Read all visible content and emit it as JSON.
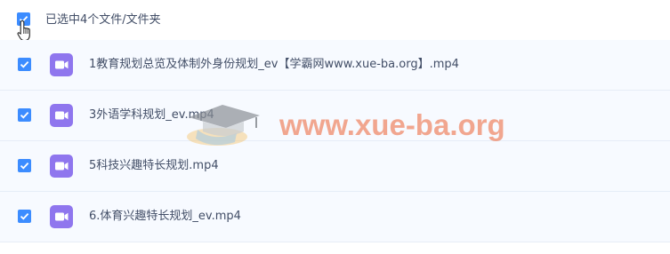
{
  "header": {
    "selection_label": "已选中4个文件/文件夹"
  },
  "files": [
    {
      "name": "1教育规划总览及体制外身份规划_ev【学霸网www.xue-ba.org】.mp4",
      "icon": "video-file-icon"
    },
    {
      "name": "3外语学科规划_ev.mp4",
      "icon": "video-file-icon"
    },
    {
      "name": "5科技兴趣特长规划.mp4",
      "icon": "video-file-icon"
    },
    {
      "name": "6.体育兴趣特长规划_ev.mp4",
      "icon": "video-file-icon"
    }
  ],
  "watermark": {
    "text": "www.xue-ba.org"
  },
  "colors": {
    "accent": "#3c8cff",
    "video_icon": "#8f76ee",
    "row_bg": "#f7faff",
    "watermark": "#f08a6a"
  }
}
